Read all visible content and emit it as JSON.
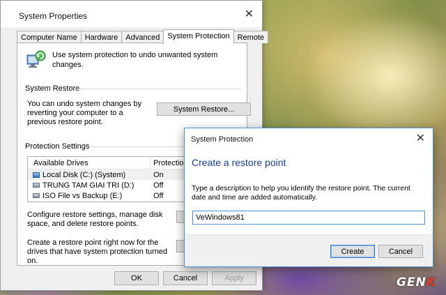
{
  "system_properties": {
    "title": "System Properties",
    "tabs": [
      {
        "label": "Computer Name"
      },
      {
        "label": "Hardware"
      },
      {
        "label": "Advanced"
      },
      {
        "label": "System Protection",
        "active": true
      },
      {
        "label": "Remote"
      }
    ],
    "intro_text": "Use system protection to undo unwanted system changes.",
    "system_restore": {
      "group_label": "System Restore",
      "description": "You can undo system changes by reverting your computer to a previous restore point.",
      "button_label": "System Restore..."
    },
    "protection_settings": {
      "group_label": "Protection Settings",
      "columns": [
        "Available Drives",
        "Protection"
      ],
      "drives": [
        {
          "name": "Local Disk (C:) (System)",
          "protection": "On",
          "system": true
        },
        {
          "name": "TRUNG TAM GIAI TRI  (D:)",
          "protection": "Off"
        },
        {
          "name": "ISO File vs Backup (E:)",
          "protection": "Off"
        }
      ],
      "configure_text": "Configure restore settings, manage disk space, and delete restore points.",
      "create_text": "Create a restore point right now for the drives that have system protection turned on."
    },
    "footer": {
      "ok": "OK",
      "cancel": "Cancel",
      "apply": "Apply"
    }
  },
  "system_protection_dialog": {
    "title": "System Protection",
    "heading": "Create a restore point",
    "description": "Type a description to help you identify the restore point. The current date and time are added automatically.",
    "input_value": "VeWindows81",
    "create_label": "Create",
    "cancel_label": "Cancel"
  },
  "watermark": {
    "text_main": "GEN",
    "text_accent": "K"
  },
  "colors": {
    "accent": "#1b3f8f",
    "focus_border": "#4a90d9",
    "logo_accent": "#e23b2b"
  }
}
